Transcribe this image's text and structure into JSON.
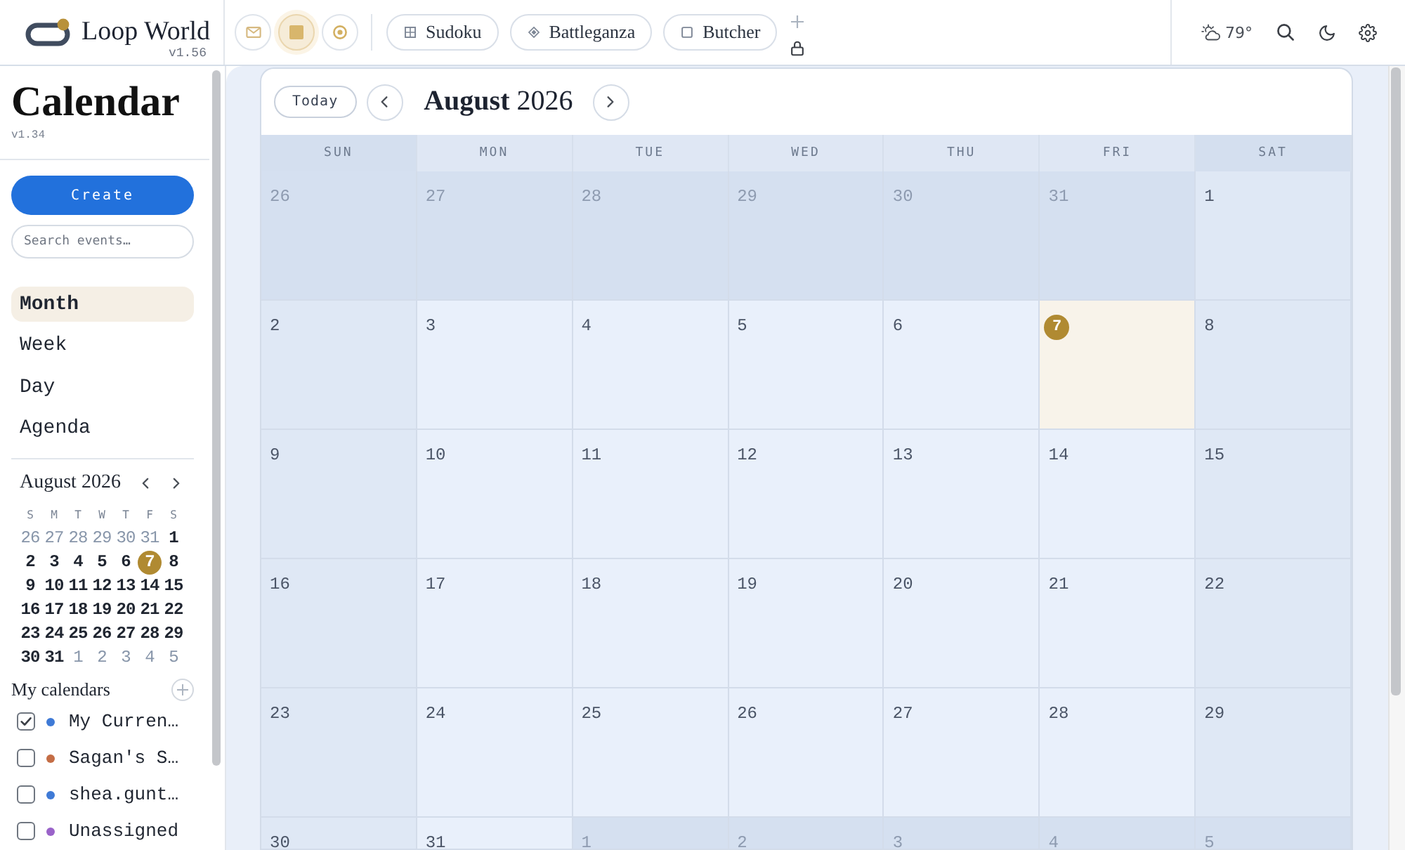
{
  "topbar": {
    "brand": {
      "name": "Loop World",
      "version": "v1.56"
    },
    "app_buttons": [
      {
        "kind": "mail",
        "selected": false
      },
      {
        "kind": "square",
        "selected": true
      },
      {
        "kind": "ring",
        "selected": false
      }
    ],
    "tabs": [
      {
        "label": "Sudoku",
        "kind": "grid"
      },
      {
        "label": "Battleganza",
        "kind": "diamond"
      },
      {
        "label": "Butcher",
        "kind": "square"
      }
    ],
    "weather": {
      "temperature": "79°"
    }
  },
  "sidebar": {
    "title": "Calendar",
    "version": "v1.34",
    "create_button": "Create",
    "search": {
      "placeholder": "Search events…"
    },
    "views": [
      {
        "label": "Month",
        "selected": true
      },
      {
        "label": "Week",
        "selected": false
      },
      {
        "label": "Day",
        "selected": false
      },
      {
        "label": "Agenda",
        "selected": false
      }
    ],
    "mini_calendar": {
      "title": "August 2026",
      "weekdays": [
        "S",
        "M",
        "T",
        "W",
        "T",
        "F",
        "S"
      ],
      "days": [
        {
          "label": "26",
          "outside_month": true,
          "selected": false
        },
        {
          "label": "27",
          "outside_month": true,
          "selected": false
        },
        {
          "label": "28",
          "outside_month": true,
          "selected": false
        },
        {
          "label": "29",
          "outside_month": true,
          "selected": false
        },
        {
          "label": "30",
          "outside_month": true,
          "selected": false
        },
        {
          "label": "31",
          "outside_month": true,
          "selected": false
        },
        {
          "label": "1",
          "outside_month": false,
          "selected": false
        },
        {
          "label": "2",
          "outside_month": false,
          "selected": false
        },
        {
          "label": "3",
          "outside_month": false,
          "selected": false
        },
        {
          "label": "4",
          "outside_month": false,
          "selected": false
        },
        {
          "label": "5",
          "outside_month": false,
          "selected": false
        },
        {
          "label": "6",
          "outside_month": false,
          "selected": false
        },
        {
          "label": "7",
          "outside_month": false,
          "selected": true
        },
        {
          "label": "8",
          "outside_month": false,
          "selected": false
        },
        {
          "label": "9",
          "outside_month": false,
          "selected": false
        },
        {
          "label": "10",
          "outside_month": false,
          "selected": false
        },
        {
          "label": "11",
          "outside_month": false,
          "selected": false
        },
        {
          "label": "12",
          "outside_month": false,
          "selected": false
        },
        {
          "label": "13",
          "outside_month": false,
          "selected": false
        },
        {
          "label": "14",
          "outside_month": false,
          "selected": false
        },
        {
          "label": "15",
          "outside_month": false,
          "selected": false
        },
        {
          "label": "16",
          "outside_month": false,
          "selected": false
        },
        {
          "label": "17",
          "outside_month": false,
          "selected": false
        },
        {
          "label": "18",
          "outside_month": false,
          "selected": false
        },
        {
          "label": "19",
          "outside_month": false,
          "selected": false
        },
        {
          "label": "20",
          "outside_month": false,
          "selected": false
        },
        {
          "label": "21",
          "outside_month": false,
          "selected": false
        },
        {
          "label": "22",
          "outside_month": false,
          "selected": false
        },
        {
          "label": "23",
          "outside_month": false,
          "selected": false
        },
        {
          "label": "24",
          "outside_month": false,
          "selected": false
        },
        {
          "label": "25",
          "outside_month": false,
          "selected": false
        },
        {
          "label": "26",
          "outside_month": false,
          "selected": false
        },
        {
          "label": "27",
          "outside_month": false,
          "selected": false
        },
        {
          "label": "28",
          "outside_month": false,
          "selected": false
        },
        {
          "label": "29",
          "outside_month": false,
          "selected": false
        },
        {
          "label": "30",
          "outside_month": false,
          "selected": false
        },
        {
          "label": "31",
          "outside_month": false,
          "selected": false
        },
        {
          "label": "1",
          "outside_month": true,
          "selected": false
        },
        {
          "label": "2",
          "outside_month": true,
          "selected": false
        },
        {
          "label": "3",
          "outside_month": true,
          "selected": false
        },
        {
          "label": "4",
          "outside_month": true,
          "selected": false
        },
        {
          "label": "5",
          "outside_month": true,
          "selected": false
        }
      ]
    },
    "calendars_heading": "My calendars",
    "calendars": [
      {
        "name": "My Curren…",
        "checked": true,
        "color": "#3f7ad6"
      },
      {
        "name": "Sagan's S…",
        "checked": false,
        "color": "#c46d45"
      },
      {
        "name": "shea.gunt…",
        "checked": false,
        "color": "#3f7ad6"
      },
      {
        "name": "Unassigned",
        "checked": false,
        "color": "#9a63c9"
      }
    ]
  },
  "main": {
    "today_button": "Today",
    "title": "**August** 2026",
    "weekdays": [
      "SUN",
      "MON",
      "TUE",
      "WED",
      "THU",
      "FRI",
      "SAT"
    ],
    "days": [
      {
        "label": "26",
        "outside_month": true,
        "today": false
      },
      {
        "label": "27",
        "outside_month": true,
        "today": false
      },
      {
        "label": "28",
        "outside_month": true,
        "today": false
      },
      {
        "label": "29",
        "outside_month": true,
        "today": false
      },
      {
        "label": "30",
        "outside_month": true,
        "today": false
      },
      {
        "label": "31",
        "outside_month": true,
        "today": false
      },
      {
        "label": "1",
        "outside_month": false,
        "today": false
      },
      {
        "label": "2",
        "outside_month": false,
        "today": false
      },
      {
        "label": "3",
        "outside_month": false,
        "today": false
      },
      {
        "label": "4",
        "outside_month": false,
        "today": false
      },
      {
        "label": "5",
        "outside_month": false,
        "today": false
      },
      {
        "label": "6",
        "outside_month": false,
        "today": false
      },
      {
        "label": "7",
        "outside_month": false,
        "today": true
      },
      {
        "label": "8",
        "outside_month": false,
        "today": false
      },
      {
        "label": "9",
        "outside_month": false,
        "today": false
      },
      {
        "label": "10",
        "outside_month": false,
        "today": false
      },
      {
        "label": "11",
        "outside_month": false,
        "today": false
      },
      {
        "label": "12",
        "outside_month": false,
        "today": false
      },
      {
        "label": "13",
        "outside_month": false,
        "today": false
      },
      {
        "label": "14",
        "outside_month": false,
        "today": false
      },
      {
        "label": "15",
        "outside_month": false,
        "today": false
      },
      {
        "label": "16",
        "outside_month": false,
        "today": false
      },
      {
        "label": "17",
        "outside_month": false,
        "today": false
      },
      {
        "label": "18",
        "outside_month": false,
        "today": false
      },
      {
        "label": "19",
        "outside_month": false,
        "today": false
      },
      {
        "label": "20",
        "outside_month": false,
        "today": false
      },
      {
        "label": "21",
        "outside_month": false,
        "today": false
      },
      {
        "label": "22",
        "outside_month": false,
        "today": false
      },
      {
        "label": "23",
        "outside_month": false,
        "today": false
      },
      {
        "label": "24",
        "outside_month": false,
        "today": false
      },
      {
        "label": "25",
        "outside_month": false,
        "today": false
      },
      {
        "label": "26",
        "outside_month": false,
        "today": false
      },
      {
        "label": "27",
        "outside_month": false,
        "today": false
      },
      {
        "label": "28",
        "outside_month": false,
        "today": false
      },
      {
        "label": "29",
        "outside_month": false,
        "today": false
      },
      {
        "label": "30",
        "outside_month": false,
        "today": false
      },
      {
        "label": "31",
        "outside_month": false,
        "today": false
      },
      {
        "label": "1",
        "outside_month": true,
        "today": false
      },
      {
        "label": "2",
        "outside_month": true,
        "today": false
      },
      {
        "label": "3",
        "outside_month": true,
        "today": false
      },
      {
        "label": "4",
        "outside_month": true,
        "today": false
      },
      {
        "label": "5",
        "outside_month": true,
        "today": false
      }
    ]
  }
}
